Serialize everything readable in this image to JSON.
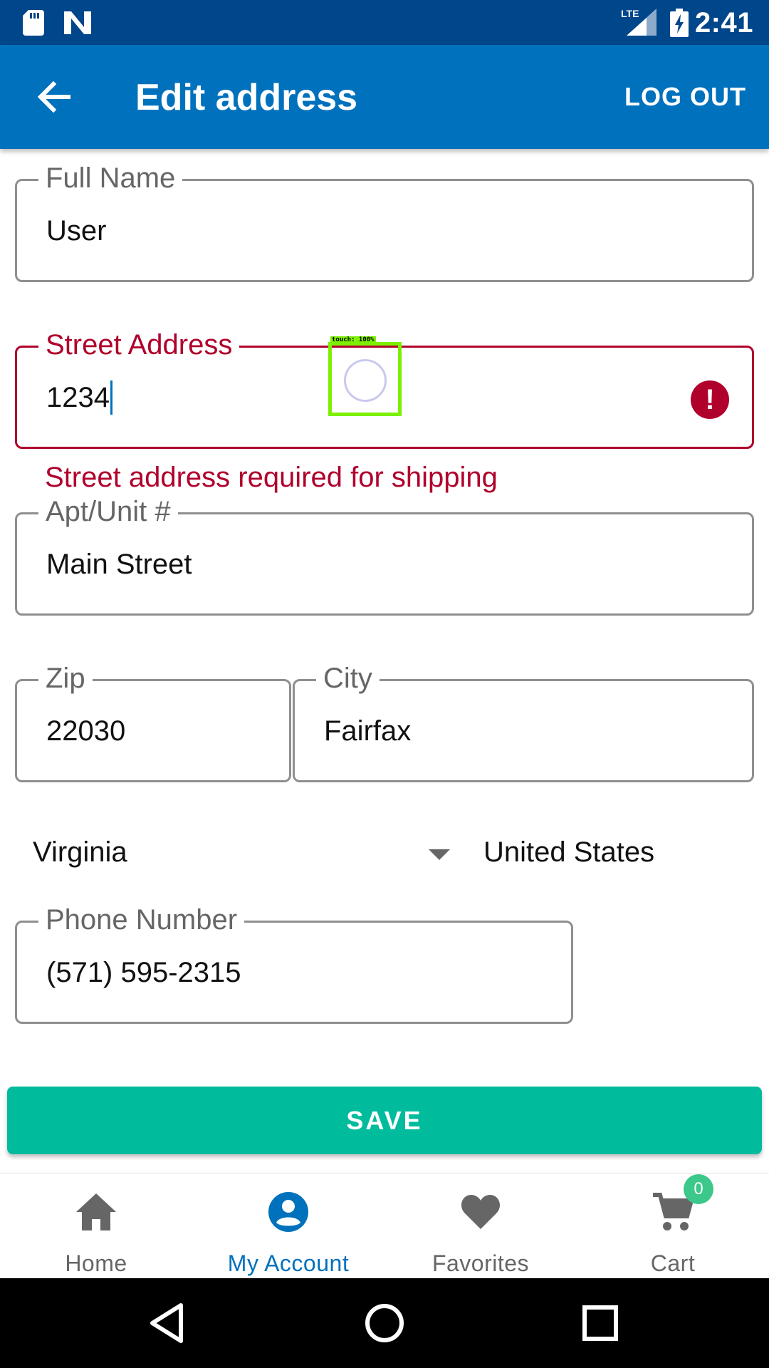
{
  "status_bar": {
    "time": "2:41",
    "icons": [
      "sd-card-icon",
      "n-notification-icon",
      "lte-signal-icon",
      "battery-charging-icon"
    ]
  },
  "app_bar": {
    "back_icon": "arrow-back-icon",
    "title": "Edit address",
    "logout_label": "LOG OUT"
  },
  "form": {
    "full_name": {
      "label": "Full Name",
      "value": "User"
    },
    "street_address": {
      "label": "Street Address",
      "value": "1234",
      "error": "Street address required for shipping",
      "error_icon": "error-icon"
    },
    "apt_unit": {
      "label": "Apt/Unit #",
      "value": "Main Street"
    },
    "zip": {
      "label": "Zip",
      "value": "22030"
    },
    "city": {
      "label": "City",
      "value": "Fairfax"
    },
    "state": {
      "value": "Virginia"
    },
    "country": {
      "value": "United States"
    },
    "phone": {
      "label": "Phone Number",
      "value": "(571) 595-2315"
    },
    "save_label": "SAVE"
  },
  "touch_overlay": {
    "label": "touch: 100%"
  },
  "bottom_nav": {
    "items": [
      {
        "label": "Home",
        "icon": "home-icon",
        "active": false
      },
      {
        "label": "My Account",
        "icon": "account-icon",
        "active": true
      },
      {
        "label": "Favorites",
        "icon": "heart-icon",
        "active": false
      },
      {
        "label": "Cart",
        "icon": "cart-icon",
        "active": false
      }
    ],
    "cart_badge": "0"
  },
  "colors": {
    "status_bar": "#00468a",
    "app_bar": "#0071bc",
    "error": "#b0002c",
    "save_button": "#00bb9c",
    "active_nav": "#0071bc",
    "badge": "#3cc88a"
  }
}
